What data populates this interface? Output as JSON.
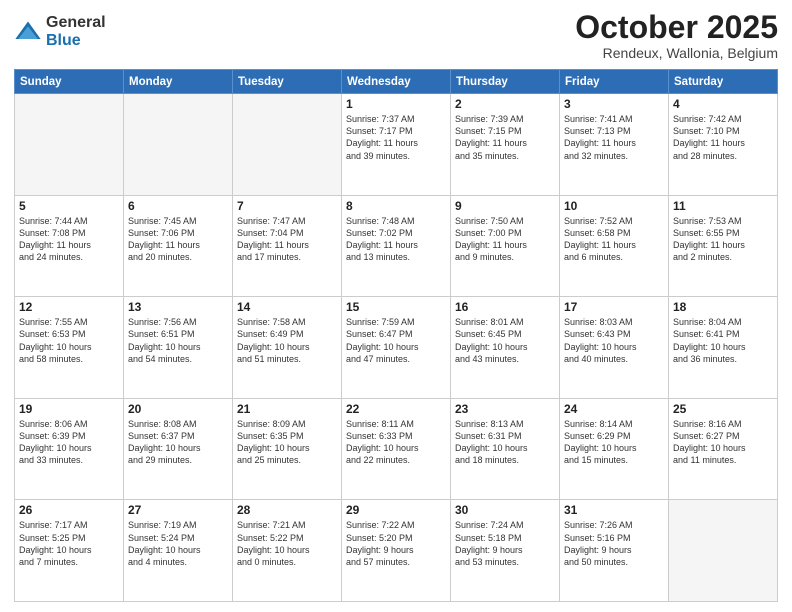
{
  "logo": {
    "general": "General",
    "blue": "Blue"
  },
  "header": {
    "month": "October 2025",
    "location": "Rendeux, Wallonia, Belgium"
  },
  "weekdays": [
    "Sunday",
    "Monday",
    "Tuesday",
    "Wednesday",
    "Thursday",
    "Friday",
    "Saturday"
  ],
  "weeks": [
    [
      {
        "day": "",
        "info": ""
      },
      {
        "day": "",
        "info": ""
      },
      {
        "day": "",
        "info": ""
      },
      {
        "day": "1",
        "info": "Sunrise: 7:37 AM\nSunset: 7:17 PM\nDaylight: 11 hours\nand 39 minutes."
      },
      {
        "day": "2",
        "info": "Sunrise: 7:39 AM\nSunset: 7:15 PM\nDaylight: 11 hours\nand 35 minutes."
      },
      {
        "day": "3",
        "info": "Sunrise: 7:41 AM\nSunset: 7:13 PM\nDaylight: 11 hours\nand 32 minutes."
      },
      {
        "day": "4",
        "info": "Sunrise: 7:42 AM\nSunset: 7:10 PM\nDaylight: 11 hours\nand 28 minutes."
      }
    ],
    [
      {
        "day": "5",
        "info": "Sunrise: 7:44 AM\nSunset: 7:08 PM\nDaylight: 11 hours\nand 24 minutes."
      },
      {
        "day": "6",
        "info": "Sunrise: 7:45 AM\nSunset: 7:06 PM\nDaylight: 11 hours\nand 20 minutes."
      },
      {
        "day": "7",
        "info": "Sunrise: 7:47 AM\nSunset: 7:04 PM\nDaylight: 11 hours\nand 17 minutes."
      },
      {
        "day": "8",
        "info": "Sunrise: 7:48 AM\nSunset: 7:02 PM\nDaylight: 11 hours\nand 13 minutes."
      },
      {
        "day": "9",
        "info": "Sunrise: 7:50 AM\nSunset: 7:00 PM\nDaylight: 11 hours\nand 9 minutes."
      },
      {
        "day": "10",
        "info": "Sunrise: 7:52 AM\nSunset: 6:58 PM\nDaylight: 11 hours\nand 6 minutes."
      },
      {
        "day": "11",
        "info": "Sunrise: 7:53 AM\nSunset: 6:55 PM\nDaylight: 11 hours\nand 2 minutes."
      }
    ],
    [
      {
        "day": "12",
        "info": "Sunrise: 7:55 AM\nSunset: 6:53 PM\nDaylight: 10 hours\nand 58 minutes."
      },
      {
        "day": "13",
        "info": "Sunrise: 7:56 AM\nSunset: 6:51 PM\nDaylight: 10 hours\nand 54 minutes."
      },
      {
        "day": "14",
        "info": "Sunrise: 7:58 AM\nSunset: 6:49 PM\nDaylight: 10 hours\nand 51 minutes."
      },
      {
        "day": "15",
        "info": "Sunrise: 7:59 AM\nSunset: 6:47 PM\nDaylight: 10 hours\nand 47 minutes."
      },
      {
        "day": "16",
        "info": "Sunrise: 8:01 AM\nSunset: 6:45 PM\nDaylight: 10 hours\nand 43 minutes."
      },
      {
        "day": "17",
        "info": "Sunrise: 8:03 AM\nSunset: 6:43 PM\nDaylight: 10 hours\nand 40 minutes."
      },
      {
        "day": "18",
        "info": "Sunrise: 8:04 AM\nSunset: 6:41 PM\nDaylight: 10 hours\nand 36 minutes."
      }
    ],
    [
      {
        "day": "19",
        "info": "Sunrise: 8:06 AM\nSunset: 6:39 PM\nDaylight: 10 hours\nand 33 minutes."
      },
      {
        "day": "20",
        "info": "Sunrise: 8:08 AM\nSunset: 6:37 PM\nDaylight: 10 hours\nand 29 minutes."
      },
      {
        "day": "21",
        "info": "Sunrise: 8:09 AM\nSunset: 6:35 PM\nDaylight: 10 hours\nand 25 minutes."
      },
      {
        "day": "22",
        "info": "Sunrise: 8:11 AM\nSunset: 6:33 PM\nDaylight: 10 hours\nand 22 minutes."
      },
      {
        "day": "23",
        "info": "Sunrise: 8:13 AM\nSunset: 6:31 PM\nDaylight: 10 hours\nand 18 minutes."
      },
      {
        "day": "24",
        "info": "Sunrise: 8:14 AM\nSunset: 6:29 PM\nDaylight: 10 hours\nand 15 minutes."
      },
      {
        "day": "25",
        "info": "Sunrise: 8:16 AM\nSunset: 6:27 PM\nDaylight: 10 hours\nand 11 minutes."
      }
    ],
    [
      {
        "day": "26",
        "info": "Sunrise: 7:17 AM\nSunset: 5:25 PM\nDaylight: 10 hours\nand 7 minutes."
      },
      {
        "day": "27",
        "info": "Sunrise: 7:19 AM\nSunset: 5:24 PM\nDaylight: 10 hours\nand 4 minutes."
      },
      {
        "day": "28",
        "info": "Sunrise: 7:21 AM\nSunset: 5:22 PM\nDaylight: 10 hours\nand 0 minutes."
      },
      {
        "day": "29",
        "info": "Sunrise: 7:22 AM\nSunset: 5:20 PM\nDaylight: 9 hours\nand 57 minutes."
      },
      {
        "day": "30",
        "info": "Sunrise: 7:24 AM\nSunset: 5:18 PM\nDaylight: 9 hours\nand 53 minutes."
      },
      {
        "day": "31",
        "info": "Sunrise: 7:26 AM\nSunset: 5:16 PM\nDaylight: 9 hours\nand 50 minutes."
      },
      {
        "day": "",
        "info": ""
      }
    ]
  ]
}
